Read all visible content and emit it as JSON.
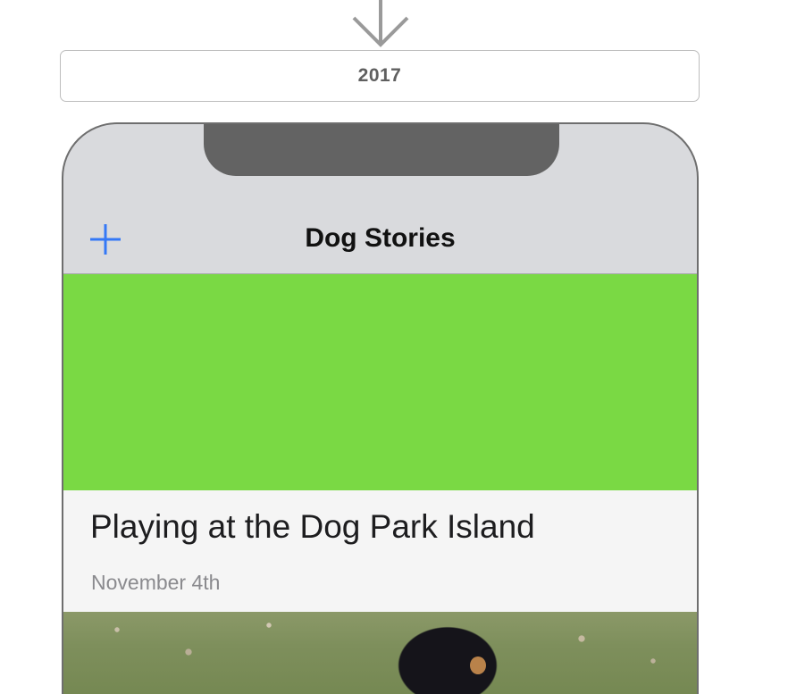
{
  "flow": {
    "arrow_icon": "down-arrow-icon",
    "year_label": "2017"
  },
  "app": {
    "navbar": {
      "title": "Dog Stories",
      "add_icon": "plus-icon",
      "accent_color": "#3478f6"
    },
    "header_color": "#7ad944",
    "story": {
      "title": "Playing at the Dog Park Island",
      "date": "November 4th"
    },
    "photo_subject": "dog-photo"
  }
}
